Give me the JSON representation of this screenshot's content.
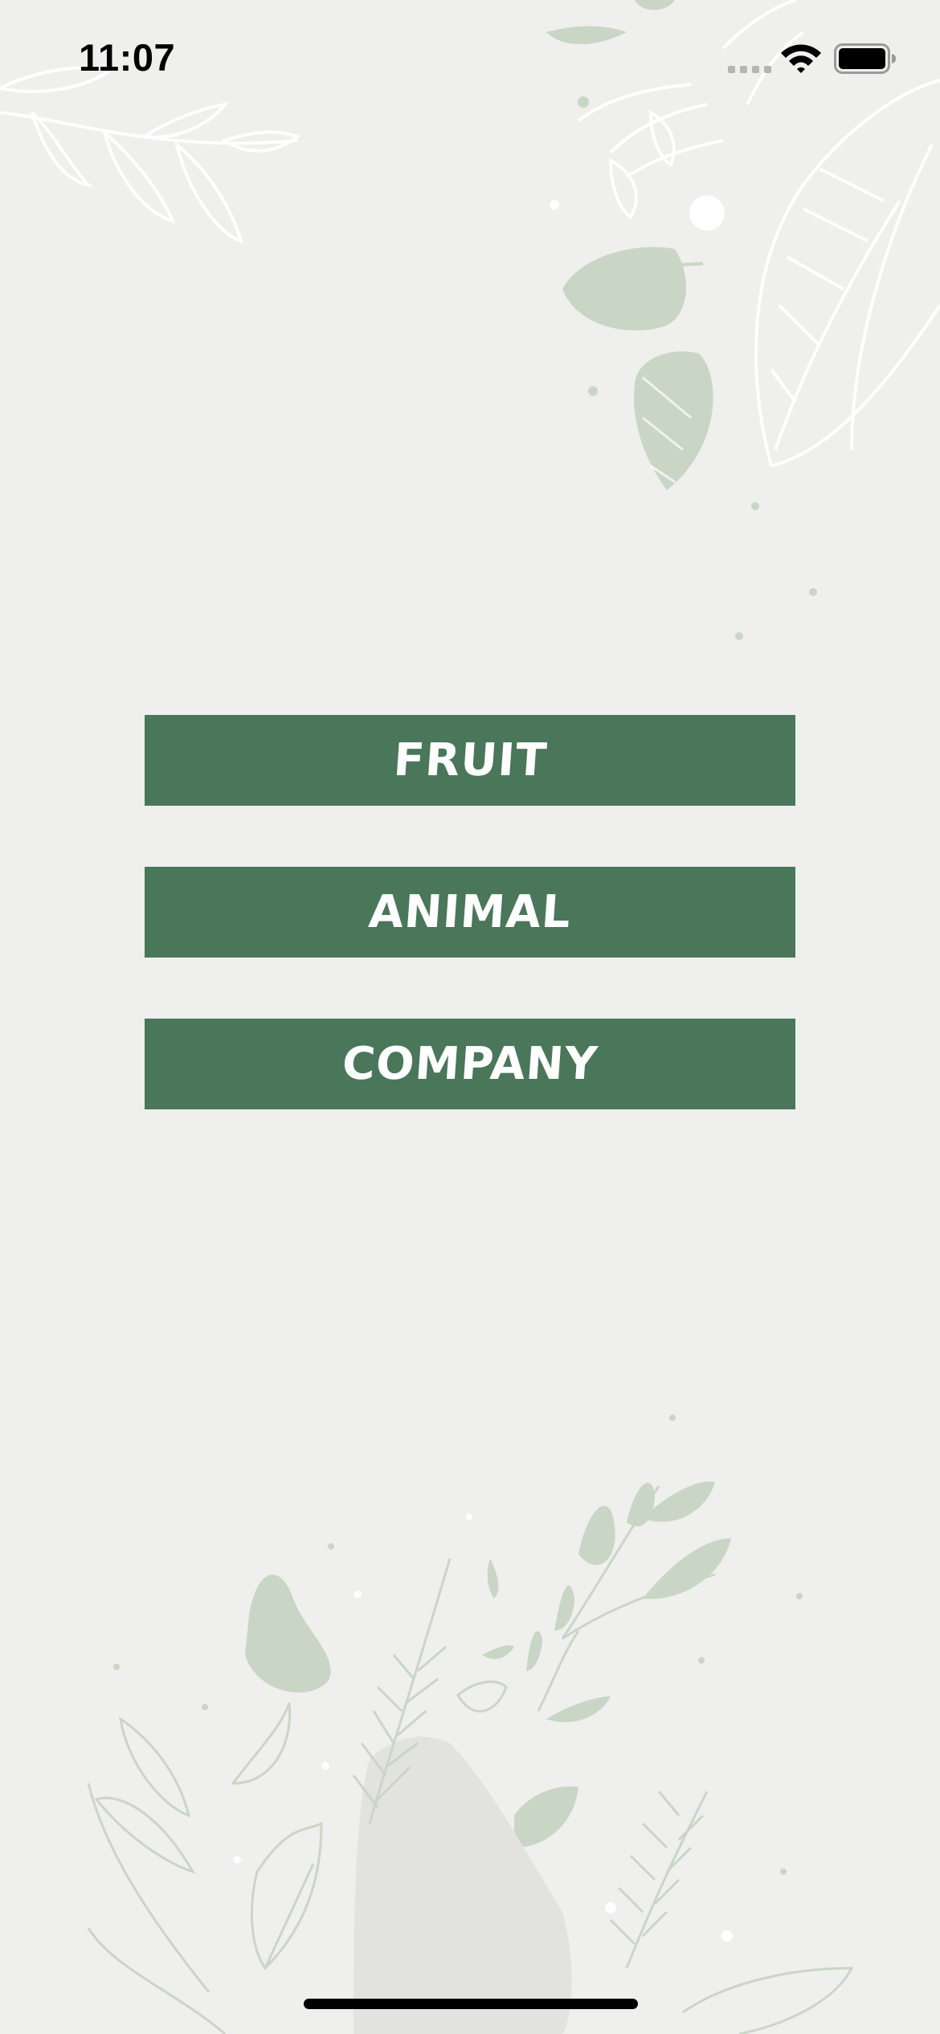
{
  "status_bar": {
    "time": "11:07",
    "icons": [
      "cellular-signal-icon",
      "wifi-icon",
      "battery-icon"
    ]
  },
  "background": {
    "description_icons": [
      "leaf-decoration-top",
      "leaf-decoration-bottom"
    ],
    "colors": {
      "page": "#efefed",
      "leaf_fill": "#c9d6c6",
      "leaf_line": "#ffffff"
    }
  },
  "menu": {
    "buttons": [
      {
        "label": "FRUIT"
      },
      {
        "label": "ANIMAL"
      },
      {
        "label": "COMPANY"
      }
    ],
    "button_color": "#4a765a",
    "text_color": "#ffffff"
  }
}
